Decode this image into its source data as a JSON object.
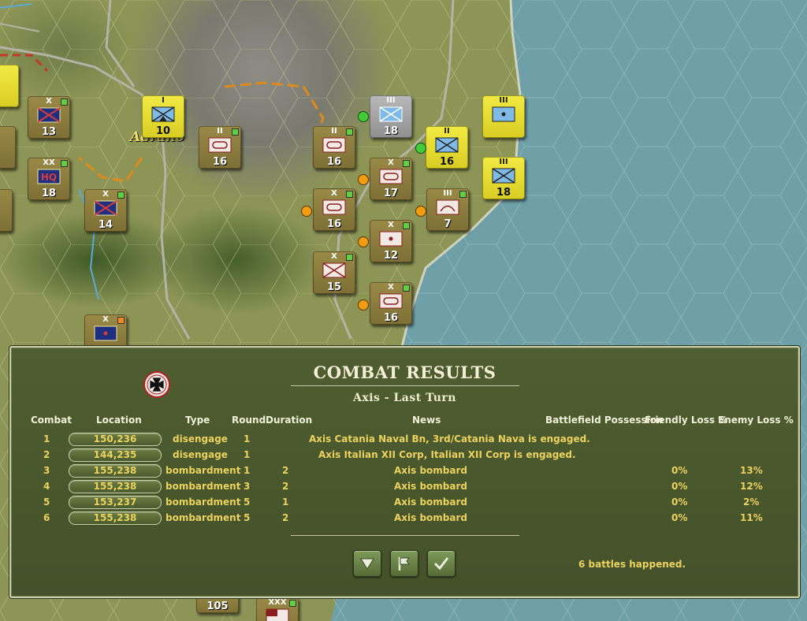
{
  "map": {
    "town_label": "Adrano",
    "units": [
      {
        "id": "u1",
        "size": "X",
        "strength": "13",
        "style": "axis-olive",
        "symbol": "infantry"
      },
      {
        "id": "u2",
        "size": "XX",
        "strength": "18",
        "style": "axis-olive",
        "symbol": "hq"
      },
      {
        "id": "u3",
        "size": "X",
        "strength": "14",
        "style": "axis-olive",
        "symbol": "infantry"
      },
      {
        "id": "u4",
        "size": "I",
        "strength": "10",
        "style": "axis-yellow",
        "symbol": "mountain"
      },
      {
        "id": "u5",
        "size": "II",
        "strength": "16",
        "style": "axis-olive",
        "symbol": "armor"
      },
      {
        "id": "u6",
        "size": "II",
        "strength": "16",
        "style": "axis-olive",
        "symbol": "armor"
      },
      {
        "id": "u7",
        "size": "X",
        "strength": "17",
        "style": "axis-olive",
        "symbol": "armor"
      },
      {
        "id": "u8",
        "size": "X",
        "strength": "16",
        "style": "axis-olive",
        "symbol": "armor"
      },
      {
        "id": "u9",
        "size": "X",
        "strength": "12",
        "style": "axis-olive",
        "symbol": "artillery"
      },
      {
        "id": "u10",
        "size": "X",
        "strength": "15",
        "style": "axis-olive",
        "symbol": "infantry"
      },
      {
        "id": "u11",
        "size": "X",
        "strength": "16",
        "style": "axis-olive",
        "symbol": "armor"
      },
      {
        "id": "u12",
        "size": "III",
        "strength": "7",
        "style": "axis-olive",
        "symbol": "engineer"
      },
      {
        "id": "u13",
        "size": "III",
        "strength": "18",
        "style": "allied-grey",
        "symbol": "infantry"
      },
      {
        "id": "u14",
        "size": "II",
        "strength": "16",
        "style": "axis-yellow",
        "symbol": "infantry"
      },
      {
        "id": "u15",
        "size": "III",
        "strength": "",
        "style": "axis-yellow",
        "symbol": "artillery"
      },
      {
        "id": "u16",
        "size": "III",
        "strength": "18",
        "style": "axis-yellow",
        "symbol": "infantry"
      },
      {
        "id": "u17",
        "size": "X",
        "strength": "",
        "style": "axis-olive",
        "symbol": "artillery"
      },
      {
        "id": "u18",
        "size": "XXX",
        "strength": "",
        "style": "axis-olive",
        "symbol": "flag"
      },
      {
        "id": "u19",
        "size": "",
        "strength": "105",
        "style": "axis-olive",
        "symbol": "none"
      }
    ]
  },
  "panel": {
    "title": "COMBAT RESULTS",
    "subtitle": "Axis - Last Turn",
    "emblem_icon": "iron-cross-icon",
    "columns": [
      "Combat",
      "Location",
      "Type",
      "Round",
      "Duration",
      "News",
      "Battlefield Possession",
      "Friendly Loss %",
      "Enemy Loss %"
    ],
    "rows": [
      {
        "combat": "1",
        "location": "150,236",
        "type": "disengage",
        "round": "1",
        "duration": "",
        "news": "Axis Catania Naval Bn, 3rd/Catania Nava is engaged.",
        "possession": "",
        "friendly_loss": "",
        "enemy_loss": ""
      },
      {
        "combat": "2",
        "location": "144,235",
        "type": "disengage",
        "round": "1",
        "duration": "",
        "news": "Axis Italian XII Corp, Italian XII Corp is engaged.",
        "possession": "",
        "friendly_loss": "",
        "enemy_loss": ""
      },
      {
        "combat": "3",
        "location": "155,238",
        "type": "bombardment",
        "round": "1",
        "duration": "2",
        "news": "Axis bombard",
        "possession": "",
        "friendly_loss": "0%",
        "enemy_loss": "13%"
      },
      {
        "combat": "4",
        "location": "155,238",
        "type": "bombardment",
        "round": "3",
        "duration": "2",
        "news": "Axis bombard",
        "possession": "",
        "friendly_loss": "0%",
        "enemy_loss": "12%"
      },
      {
        "combat": "5",
        "location": "153,237",
        "type": "bombardment",
        "round": "5",
        "duration": "1",
        "news": "Axis bombard",
        "possession": "",
        "friendly_loss": "0%",
        "enemy_loss": "2%"
      },
      {
        "combat": "6",
        "location": "155,238",
        "type": "bombardment",
        "round": "5",
        "duration": "2",
        "news": "Axis bombard",
        "possession": "",
        "friendly_loss": "0%",
        "enemy_loss": "11%"
      }
    ],
    "buttons": [
      {
        "name": "scroll-down-button",
        "icon": "triangle-down-icon"
      },
      {
        "name": "goto-battle-button",
        "icon": "flag-icon"
      },
      {
        "name": "confirm-button",
        "icon": "checkmark-icon"
      }
    ],
    "status": "6 battles happened.",
    "colors": {
      "panel_bg": "#4a5a2e",
      "text_yellow": "#ebd25e",
      "text_header": "#f1f0da",
      "sea": "#6fa0a8",
      "land": "#8c9556"
    }
  }
}
